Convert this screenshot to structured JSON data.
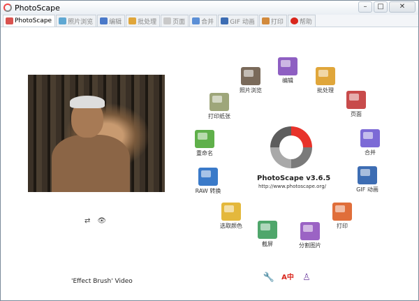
{
  "window": {
    "title": "PhotoScape",
    "min": "–",
    "max": "□",
    "close": "✕"
  },
  "tabs": [
    {
      "label": "PhotoScape",
      "color": "#d9534f"
    },
    {
      "label": "照片浏览",
      "color": "#5fa8d3"
    },
    {
      "label": "编辑",
      "color": "#4a79c9"
    },
    {
      "label": "批处理",
      "color": "#e0a63a"
    },
    {
      "label": "页面",
      "color": "#c9c9c9"
    },
    {
      "label": "合并",
      "color": "#5b8fd6"
    },
    {
      "label": "GIF 动画",
      "color": "#3d6db3"
    },
    {
      "label": "打印",
      "color": "#d28a3c"
    },
    {
      "label": "帮助",
      "color": "#d9261c"
    }
  ],
  "left_panel": {
    "mini_icons": [
      "⇄",
      "👁"
    ],
    "caption": "'Effect Brush' Video"
  },
  "logo": {
    "name": "PhotoScape v3.6.5",
    "url": "http://www.photoscape.org/"
  },
  "menu": [
    {
      "label": "照片浏览",
      "color": "#7a6a5a"
    },
    {
      "label": "编辑",
      "color": "#8e5fc2"
    },
    {
      "label": "批处理",
      "color": "#e0a63a"
    },
    {
      "label": "页面",
      "color": "#c84b4b"
    },
    {
      "label": "合并",
      "color": "#7c6ad6"
    },
    {
      "label": "GIF 动画",
      "color": "#3d6db3"
    },
    {
      "label": "打印",
      "color": "#e06e3a"
    },
    {
      "label": "分割图片",
      "color": "#9b63c4"
    },
    {
      "label": "截屏",
      "color": "#4fa66b"
    },
    {
      "label": "选取颜色",
      "color": "#e4b83c"
    },
    {
      "label": "RAW 转换",
      "color": "#3a7ac9"
    },
    {
      "label": "重命名",
      "color": "#5fb04a"
    },
    {
      "label": "打印纸张",
      "color": "#9ea67a"
    }
  ],
  "bottom_icons": [
    "🔧",
    "A中",
    "♙"
  ]
}
